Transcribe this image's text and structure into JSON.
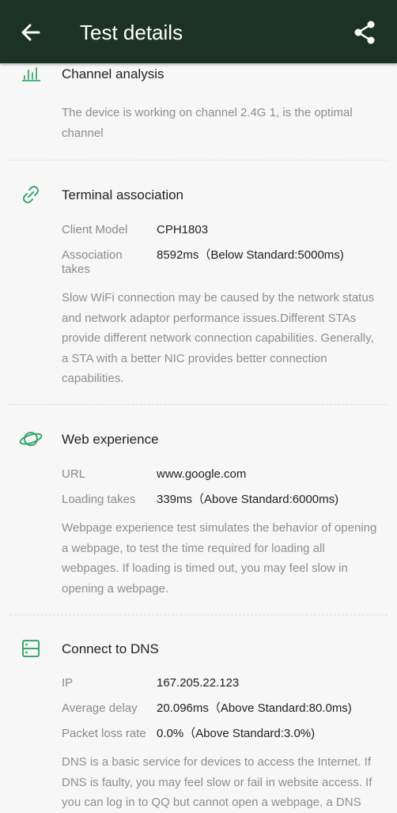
{
  "header": {
    "title": "Test details",
    "bg_color": "#1c3324"
  },
  "accent_color": "#3aa86b",
  "channel": {
    "title": "Channel analysis",
    "icon": "bar-chart-icon",
    "description": "The device is working on channel 2.4G 1, is the optimal channel"
  },
  "terminal": {
    "title": "Terminal association",
    "icon": "link-icon",
    "rows": [
      {
        "label": "Client Model",
        "value": "CPH1803"
      },
      {
        "label": "Association takes",
        "value": "8592ms（Below Standard:5000ms)"
      }
    ],
    "description": "Slow WiFi connection may be caused by the network status and network adaptor performance issues.Different STAs provide different network connection capabilities.  Generally, a STA with a better NIC provides better connection capabilities."
  },
  "web": {
    "title": "Web experience",
    "icon": "planet-icon",
    "rows": [
      {
        "label": "URL",
        "value": "www.google.com"
      },
      {
        "label": "Loading takes",
        "value": "339ms（Above Standard:6000ms)"
      }
    ],
    "description": "Webpage experience test simulates the behavior of opening a webpage, to test the time required for loading all webpages. If loading is timed out, you may feel slow in opening a webpage."
  },
  "dns": {
    "title": "Connect to DNS",
    "icon": "server-icon",
    "rows": [
      {
        "label": "IP",
        "value": "167.205.22.123"
      },
      {
        "label": "Average delay",
        "value": "20.096ms（Above Standard:80.0ms)"
      },
      {
        "label": "Packet loss rate",
        "value": "0.0%（Above Standard:3.0%)"
      }
    ],
    "description": "DNS is a basic service for devices to access the Internet. If DNS is faulty, you may feel slow or fail in website access. If you can log in to QQ but cannot open a webpage, a DNS"
  }
}
